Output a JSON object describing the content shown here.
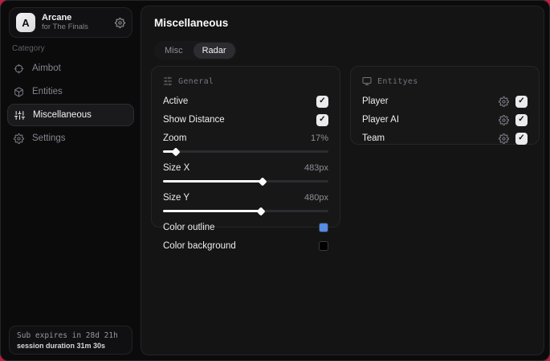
{
  "app": {
    "name": "Arcane",
    "subtitle": "for The Finals",
    "logo_letter": "A"
  },
  "glyphs": {
    "check": "✓"
  },
  "colors": {
    "accent_red": "#bf1e40",
    "panel_bg": "#141415",
    "card_bg": "#171718"
  },
  "sidebar": {
    "category_label": "Category",
    "items": [
      {
        "label": "Aimbot",
        "icon": "crosshair-icon",
        "active": false
      },
      {
        "label": "Entities",
        "icon": "cube-icon",
        "active": false
      },
      {
        "label": "Miscellaneous",
        "icon": "sliders-icon",
        "active": true
      },
      {
        "label": "Settings",
        "icon": "gear-icon",
        "active": false
      }
    ],
    "footer": {
      "sub_expires": "Sub expires in 28d 21h",
      "session_duration": "session duration 31m 30s"
    }
  },
  "main": {
    "title": "Miscellaneous",
    "tabs": [
      {
        "label": "Misc",
        "active": false
      },
      {
        "label": "Radar",
        "active": true
      }
    ],
    "general": {
      "header": "General",
      "toggles": [
        {
          "label": "Active",
          "checked": true
        },
        {
          "label": "Show Distance",
          "checked": true
        }
      ],
      "sliders": [
        {
          "label": "Zoom",
          "value": "17%",
          "fill": "8%"
        },
        {
          "label": "Size X",
          "value": "483px",
          "fill": "60%"
        },
        {
          "label": "Size Y",
          "value": "480px",
          "fill": "59%"
        }
      ],
      "color_rows": [
        {
          "label": "Color outline",
          "swatch": "#548ce8"
        },
        {
          "label": "Color background",
          "swatch": "#000000"
        }
      ]
    },
    "entities": {
      "header": "Entityes",
      "rows": [
        {
          "label": "Player",
          "checked": true
        },
        {
          "label": "Player AI",
          "checked": true
        },
        {
          "label": "Team",
          "checked": true
        }
      ]
    }
  }
}
